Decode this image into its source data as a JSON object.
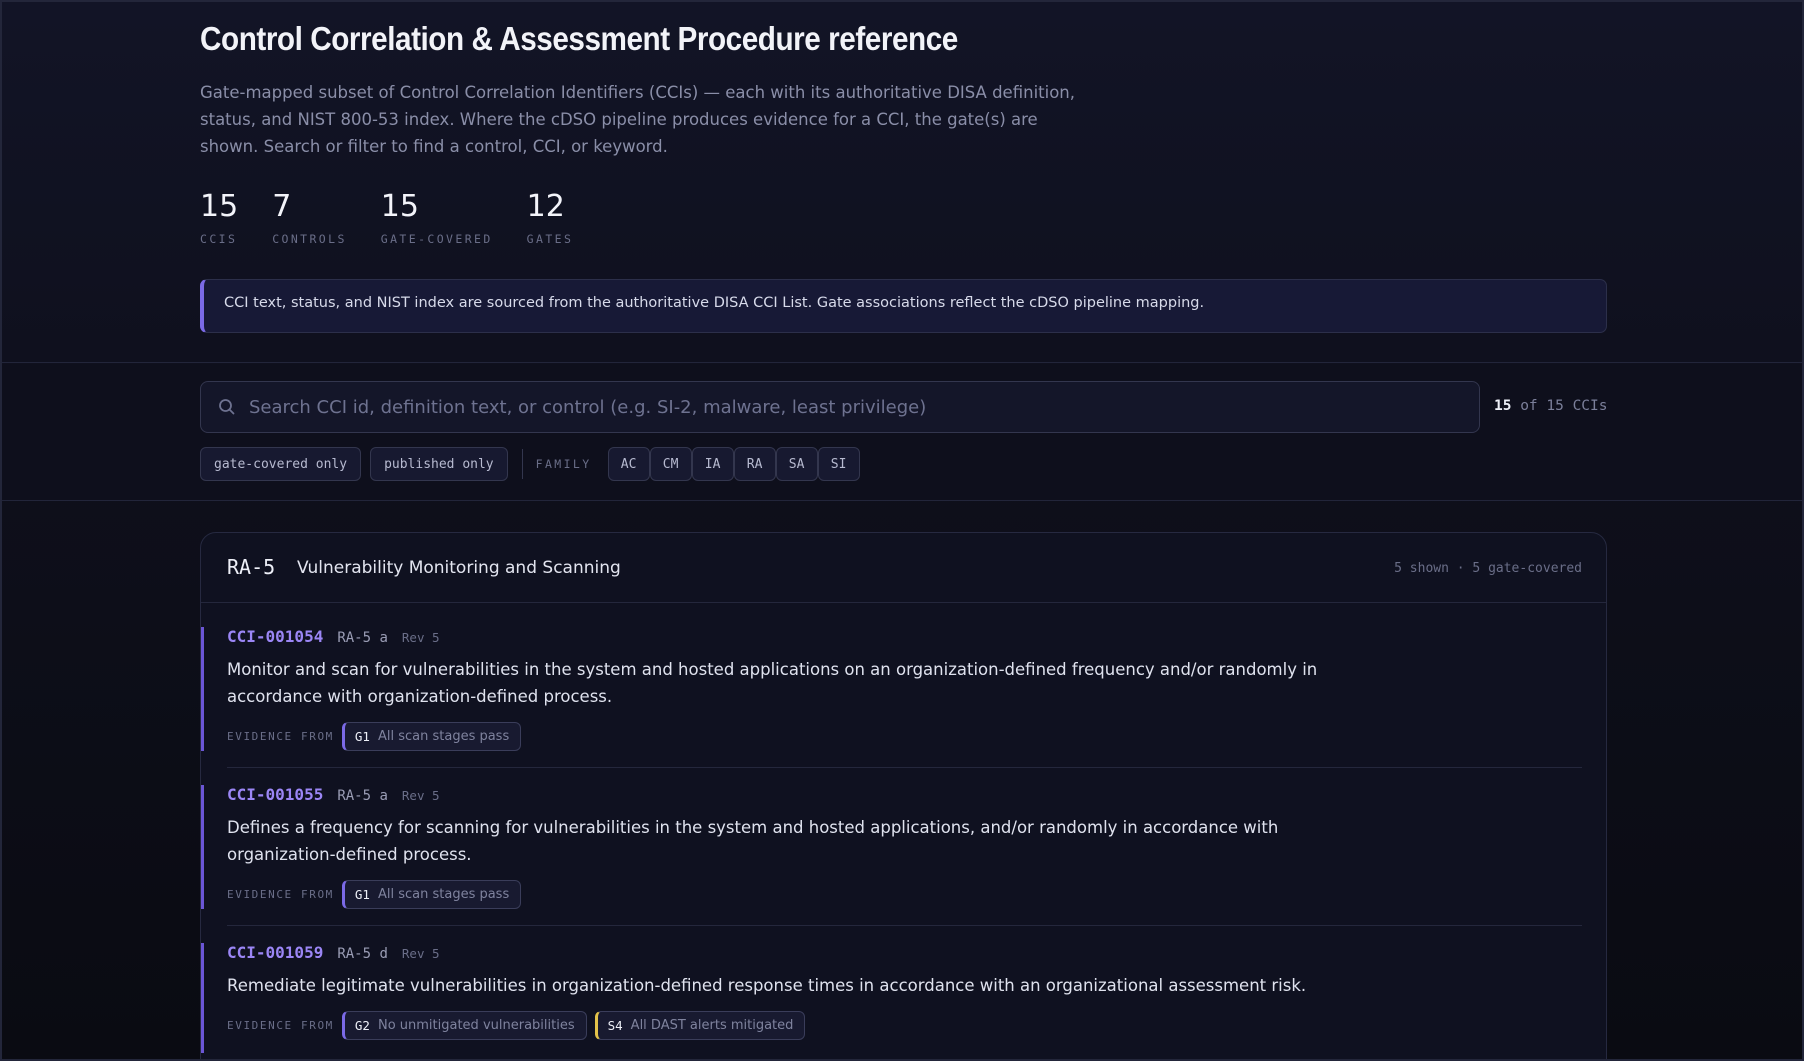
{
  "header": {
    "title": "Control Correlation & Assessment Procedure reference",
    "subtitle": "Gate-mapped subset of Control Correlation Identifiers (CCIs) — each with its authoritative DISA definition, status, and NIST 800-53 index. Where the cDSO pipeline produces evidence for a CCI, the gate(s) are shown. Search or filter to find a control, CCI, or keyword."
  },
  "stats": [
    {
      "value": "15",
      "label": "CCIS"
    },
    {
      "value": "7",
      "label": "CONTROLS"
    },
    {
      "value": "15",
      "label": "GATE-COVERED"
    },
    {
      "value": "12",
      "label": "GATES"
    }
  ],
  "notice": "CCI text, status, and NIST index are sourced from the authoritative DISA CCI List. Gate associations reflect the cDSO pipeline mapping.",
  "search": {
    "placeholder": "Search CCI id, definition text, or control (e.g. SI-2, malware, least privilege)",
    "value": "",
    "icon": "search-icon"
  },
  "count": {
    "shown": "15",
    "rest": "of 15 CCIs"
  },
  "filters": {
    "gate_covered": "gate-covered only",
    "published": "published only",
    "family_label": "FAMILY",
    "families": [
      "AC",
      "CM",
      "IA",
      "RA",
      "SA",
      "SI"
    ]
  },
  "group": {
    "id": "RA-5",
    "title": "Vulnerability Monitoring and Scanning",
    "meta": "5 shown · 5 gate-covered",
    "evidence_label": "EVIDENCE FROM",
    "ccis": [
      {
        "id": "CCI-001054",
        "control": "RA-5 a",
        "rev": "Rev 5",
        "text": "Monitor and scan for vulnerabilities in the system and hosted applications on an organization-defined frequency and/or randomly in accordance with organization-defined process.",
        "gates": [
          {
            "code": "G1",
            "desc": "All scan stages pass",
            "accent": "#7b6ae6"
          }
        ]
      },
      {
        "id": "CCI-001055",
        "control": "RA-5 a",
        "rev": "Rev 5",
        "text": "Defines a frequency for scanning for vulnerabilities in the system and hosted applications, and/or randomly in accordance with organization-defined process.",
        "gates": [
          {
            "code": "G1",
            "desc": "All scan stages pass",
            "accent": "#7b6ae6"
          }
        ]
      },
      {
        "id": "CCI-001059",
        "control": "RA-5 d",
        "rev": "Rev 5",
        "text": "Remediate legitimate vulnerabilities in organization-defined response times in accordance with an organizational assessment risk.",
        "gates": [
          {
            "code": "G2",
            "desc": "No unmitigated vulnerabilities",
            "accent": "#7b6ae6"
          },
          {
            "code": "S4",
            "desc": "All DAST alerts mitigated",
            "accent": "#e3c24a"
          }
        ]
      }
    ]
  }
}
